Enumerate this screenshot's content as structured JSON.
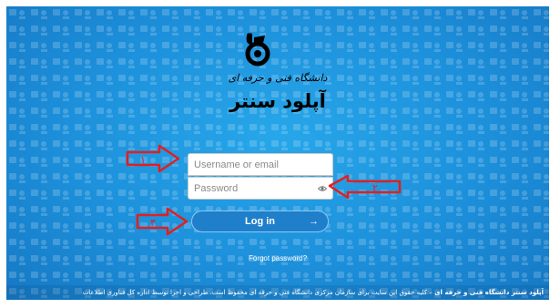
{
  "brand": {
    "university_name": "دانشگاه فنی و حرفه ای",
    "app_title": "آپلود سنتر",
    "logo_icon": "university-logo-icon"
  },
  "login": {
    "username_placeholder": "Username or email",
    "password_placeholder": "Password",
    "password_toggle_icon": "eye-icon",
    "submit_label": "Log in",
    "submit_icon": "arrow-right-icon",
    "forgot_label": "Forgot password?"
  },
  "annotations": {
    "arrow_1": "۱",
    "arrow_2": "۲",
    "arrow_3": "۳",
    "color": "#e02020"
  },
  "footer": {
    "site_name": "آپلود سنتر دانشگاه فنی و حرفه ای",
    "rights_text": " – کلیه حقوق این سایت برای سازمان مرکزی دانشگاه فنی و حرفه ای محفوظ است. طراحی و اجرا توسط اداره کل فناوری اطلاعات"
  },
  "colors": {
    "background": "#1d90db",
    "button": "#1f7fcb"
  }
}
